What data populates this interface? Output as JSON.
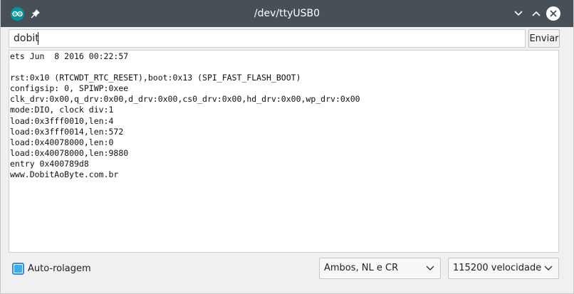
{
  "window": {
    "title": "/dev/ttyUSB0"
  },
  "input": {
    "value": "dobit"
  },
  "send_button": {
    "label": "Enviar"
  },
  "output_lines": [
    "ets Jun  8 2016 00:22:57",
    "",
    "rst:0x10 (RTCWDT_RTC_RESET),boot:0x13 (SPI_FAST_FLASH_BOOT)",
    "configsip: 0, SPIWP:0xee",
    "clk_drv:0x00,q_drv:0x00,d_drv:0x00,cs0_drv:0x00,hd_drv:0x00,wp_drv:0x00",
    "mode:DIO, clock div:1",
    "load:0x3fff0010,len:4",
    "load:0x3fff0014,len:572",
    "load:0x40078000,len:0",
    "load:0x40078000,len:9880",
    "entry 0x400789d8",
    "www.DobitAoByte.com.br"
  ],
  "autoscroll": {
    "label": "Auto-rolagem",
    "checked": true
  },
  "line_ending": {
    "selected": "Ambos, NL e CR"
  },
  "baud_rate": {
    "selected": "115200 velocidade"
  },
  "colors": {
    "titlebar": "#475057",
    "app_icon": "#00979d",
    "checkbox": "#3daee9"
  }
}
